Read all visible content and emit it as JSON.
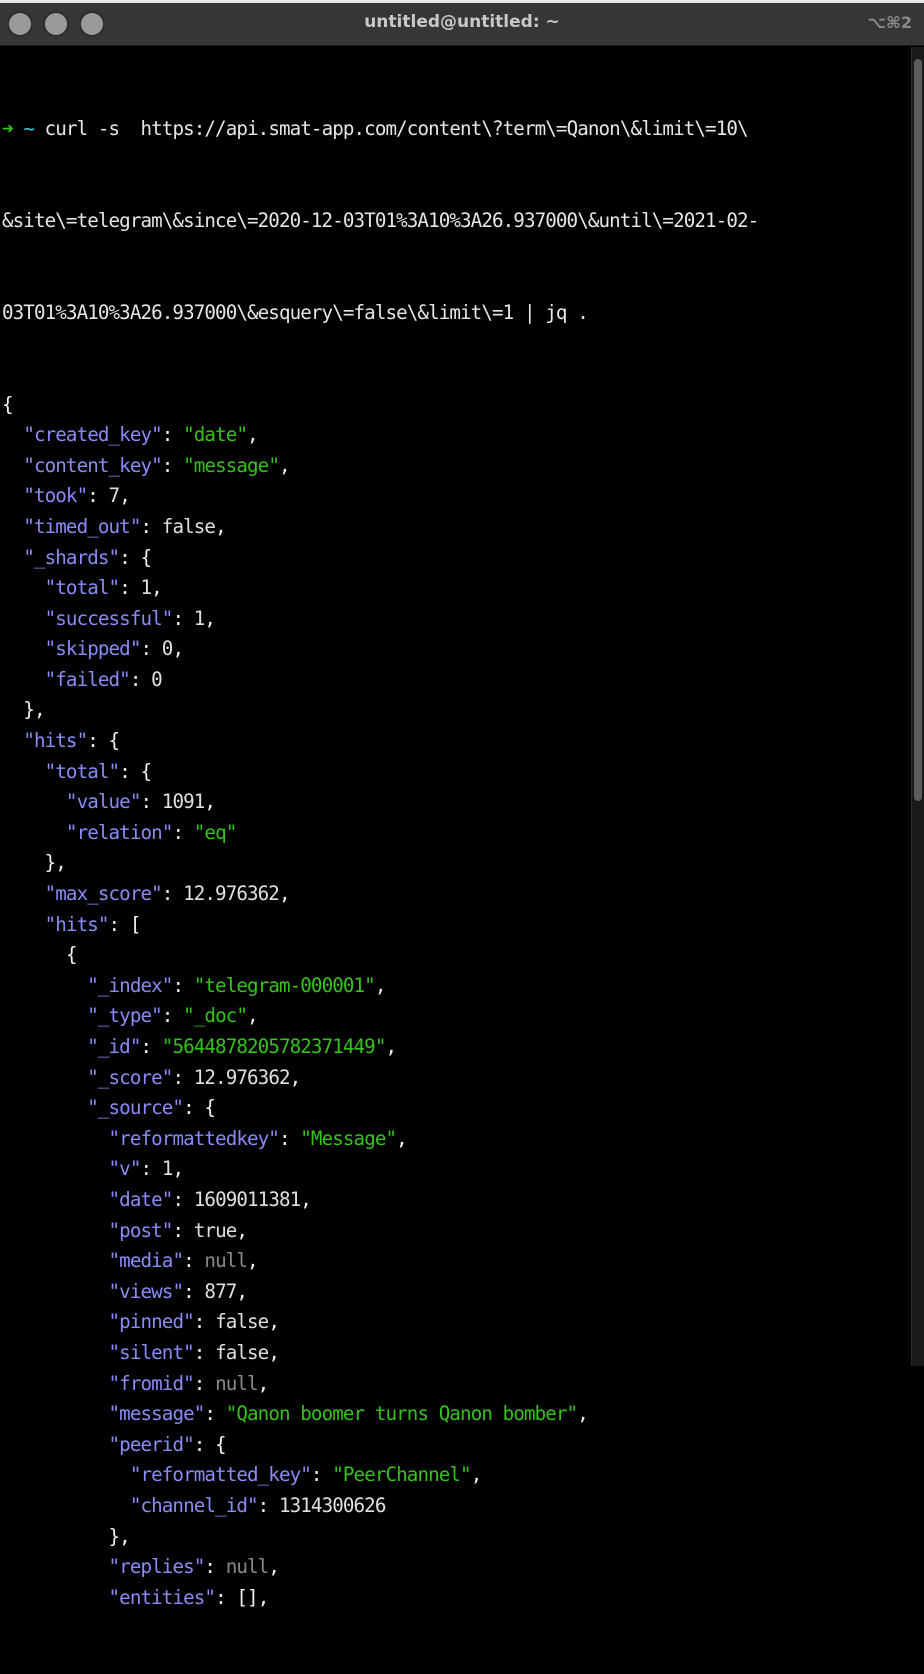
{
  "window": {
    "title": "untitled@untitled: ~",
    "shortcut": "⌥⌘2",
    "scroll_position": 0.0,
    "scroll_visible_fraction": 0.56
  },
  "prompt": {
    "arrow": "➜",
    "cwd": "~",
    "command_lines": [
      "curl -s  https://api.smat-app.com/content\\?term\\=Qanon\\&limit\\=10\\",
      "&site\\=telegram\\&since\\=2020-12-03T01%3A10%3A26.937000\\&until\\=2021-02-",
      "03T01%3A10%3A26.937000\\&esquery\\=false\\&limit\\=1 | jq ."
    ]
  },
  "output_lines": [
    {
      "indent": 0,
      "tokens": [
        {
          "t": "p",
          "v": "{"
        }
      ]
    },
    {
      "indent": 1,
      "tokens": [
        {
          "t": "k",
          "v": "\"created_key\""
        },
        {
          "t": "p",
          "v": ": "
        },
        {
          "t": "s",
          "v": "\"date\""
        },
        {
          "t": "p",
          "v": ","
        }
      ]
    },
    {
      "indent": 1,
      "tokens": [
        {
          "t": "k",
          "v": "\"content_key\""
        },
        {
          "t": "p",
          "v": ": "
        },
        {
          "t": "s",
          "v": "\"message\""
        },
        {
          "t": "p",
          "v": ","
        }
      ]
    },
    {
      "indent": 1,
      "tokens": [
        {
          "t": "k",
          "v": "\"took\""
        },
        {
          "t": "p",
          "v": ": "
        },
        {
          "t": "n",
          "v": "7"
        },
        {
          "t": "p",
          "v": ","
        }
      ]
    },
    {
      "indent": 1,
      "tokens": [
        {
          "t": "k",
          "v": "\"timed_out\""
        },
        {
          "t": "p",
          "v": ": "
        },
        {
          "t": "n",
          "v": "false"
        },
        {
          "t": "p",
          "v": ","
        }
      ]
    },
    {
      "indent": 1,
      "tokens": [
        {
          "t": "k",
          "v": "\"_shards\""
        },
        {
          "t": "p",
          "v": ": {"
        }
      ]
    },
    {
      "indent": 2,
      "tokens": [
        {
          "t": "k",
          "v": "\"total\""
        },
        {
          "t": "p",
          "v": ": "
        },
        {
          "t": "n",
          "v": "1"
        },
        {
          "t": "p",
          "v": ","
        }
      ]
    },
    {
      "indent": 2,
      "tokens": [
        {
          "t": "k",
          "v": "\"successful\""
        },
        {
          "t": "p",
          "v": ": "
        },
        {
          "t": "n",
          "v": "1"
        },
        {
          "t": "p",
          "v": ","
        }
      ]
    },
    {
      "indent": 2,
      "tokens": [
        {
          "t": "k",
          "v": "\"skipped\""
        },
        {
          "t": "p",
          "v": ": "
        },
        {
          "t": "n",
          "v": "0"
        },
        {
          "t": "p",
          "v": ","
        }
      ]
    },
    {
      "indent": 2,
      "tokens": [
        {
          "t": "k",
          "v": "\"failed\""
        },
        {
          "t": "p",
          "v": ": "
        },
        {
          "t": "n",
          "v": "0"
        }
      ]
    },
    {
      "indent": 1,
      "tokens": [
        {
          "t": "p",
          "v": "},"
        }
      ]
    },
    {
      "indent": 1,
      "tokens": [
        {
          "t": "k",
          "v": "\"hits\""
        },
        {
          "t": "p",
          "v": ": {"
        }
      ]
    },
    {
      "indent": 2,
      "tokens": [
        {
          "t": "k",
          "v": "\"total\""
        },
        {
          "t": "p",
          "v": ": {"
        }
      ]
    },
    {
      "indent": 3,
      "tokens": [
        {
          "t": "k",
          "v": "\"value\""
        },
        {
          "t": "p",
          "v": ": "
        },
        {
          "t": "n",
          "v": "1091"
        },
        {
          "t": "p",
          "v": ","
        }
      ]
    },
    {
      "indent": 3,
      "tokens": [
        {
          "t": "k",
          "v": "\"relation\""
        },
        {
          "t": "p",
          "v": ": "
        },
        {
          "t": "s",
          "v": "\"eq\""
        }
      ]
    },
    {
      "indent": 2,
      "tokens": [
        {
          "t": "p",
          "v": "},"
        }
      ]
    },
    {
      "indent": 2,
      "tokens": [
        {
          "t": "k",
          "v": "\"max_score\""
        },
        {
          "t": "p",
          "v": ": "
        },
        {
          "t": "n",
          "v": "12.976362"
        },
        {
          "t": "p",
          "v": ","
        }
      ]
    },
    {
      "indent": 2,
      "tokens": [
        {
          "t": "k",
          "v": "\"hits\""
        },
        {
          "t": "p",
          "v": ": ["
        }
      ]
    },
    {
      "indent": 3,
      "tokens": [
        {
          "t": "p",
          "v": "{"
        }
      ]
    },
    {
      "indent": 4,
      "tokens": [
        {
          "t": "k",
          "v": "\"_index\""
        },
        {
          "t": "p",
          "v": ": "
        },
        {
          "t": "s",
          "v": "\"telegram-000001\""
        },
        {
          "t": "p",
          "v": ","
        }
      ]
    },
    {
      "indent": 4,
      "tokens": [
        {
          "t": "k",
          "v": "\"_type\""
        },
        {
          "t": "p",
          "v": ": "
        },
        {
          "t": "s",
          "v": "\"_doc\""
        },
        {
          "t": "p",
          "v": ","
        }
      ]
    },
    {
      "indent": 4,
      "tokens": [
        {
          "t": "k",
          "v": "\"_id\""
        },
        {
          "t": "p",
          "v": ": "
        },
        {
          "t": "s",
          "v": "\"5644878205782371449\""
        },
        {
          "t": "p",
          "v": ","
        }
      ]
    },
    {
      "indent": 4,
      "tokens": [
        {
          "t": "k",
          "v": "\"_score\""
        },
        {
          "t": "p",
          "v": ": "
        },
        {
          "t": "n",
          "v": "12.976362"
        },
        {
          "t": "p",
          "v": ","
        }
      ]
    },
    {
      "indent": 4,
      "tokens": [
        {
          "t": "k",
          "v": "\"_source\""
        },
        {
          "t": "p",
          "v": ": {"
        }
      ]
    },
    {
      "indent": 5,
      "tokens": [
        {
          "t": "k",
          "v": "\"reformattedkey\""
        },
        {
          "t": "p",
          "v": ": "
        },
        {
          "t": "s",
          "v": "\"Message\""
        },
        {
          "t": "p",
          "v": ","
        }
      ]
    },
    {
      "indent": 5,
      "tokens": [
        {
          "t": "k",
          "v": "\"v\""
        },
        {
          "t": "p",
          "v": ": "
        },
        {
          "t": "n",
          "v": "1"
        },
        {
          "t": "p",
          "v": ","
        }
      ]
    },
    {
      "indent": 5,
      "tokens": [
        {
          "t": "k",
          "v": "\"date\""
        },
        {
          "t": "p",
          "v": ": "
        },
        {
          "t": "n",
          "v": "1609011381"
        },
        {
          "t": "p",
          "v": ","
        }
      ]
    },
    {
      "indent": 5,
      "tokens": [
        {
          "t": "k",
          "v": "\"post\""
        },
        {
          "t": "p",
          "v": ": "
        },
        {
          "t": "n",
          "v": "true"
        },
        {
          "t": "p",
          "v": ","
        }
      ]
    },
    {
      "indent": 5,
      "tokens": [
        {
          "t": "k",
          "v": "\"media\""
        },
        {
          "t": "p",
          "v": ": "
        },
        {
          "t": "nl",
          "v": "null"
        },
        {
          "t": "p",
          "v": ","
        }
      ]
    },
    {
      "indent": 5,
      "tokens": [
        {
          "t": "k",
          "v": "\"views\""
        },
        {
          "t": "p",
          "v": ": "
        },
        {
          "t": "n",
          "v": "877"
        },
        {
          "t": "p",
          "v": ","
        }
      ]
    },
    {
      "indent": 5,
      "tokens": [
        {
          "t": "k",
          "v": "\"pinned\""
        },
        {
          "t": "p",
          "v": ": "
        },
        {
          "t": "n",
          "v": "false"
        },
        {
          "t": "p",
          "v": ","
        }
      ]
    },
    {
      "indent": 5,
      "tokens": [
        {
          "t": "k",
          "v": "\"silent\""
        },
        {
          "t": "p",
          "v": ": "
        },
        {
          "t": "n",
          "v": "false"
        },
        {
          "t": "p",
          "v": ","
        }
      ]
    },
    {
      "indent": 5,
      "tokens": [
        {
          "t": "k",
          "v": "\"fromid\""
        },
        {
          "t": "p",
          "v": ": "
        },
        {
          "t": "nl",
          "v": "null"
        },
        {
          "t": "p",
          "v": ","
        }
      ]
    },
    {
      "indent": 5,
      "tokens": [
        {
          "t": "k",
          "v": "\"message\""
        },
        {
          "t": "p",
          "v": ": "
        },
        {
          "t": "s",
          "v": "\"Qanon boomer turns Qanon bomber\""
        },
        {
          "t": "p",
          "v": ","
        }
      ]
    },
    {
      "indent": 5,
      "tokens": [
        {
          "t": "k",
          "v": "\"peerid\""
        },
        {
          "t": "p",
          "v": ": {"
        }
      ]
    },
    {
      "indent": 6,
      "tokens": [
        {
          "t": "k",
          "v": "\"reformatted_key\""
        },
        {
          "t": "p",
          "v": ": "
        },
        {
          "t": "s",
          "v": "\"PeerChannel\""
        },
        {
          "t": "p",
          "v": ","
        }
      ]
    },
    {
      "indent": 6,
      "tokens": [
        {
          "t": "k",
          "v": "\"channel_id\""
        },
        {
          "t": "p",
          "v": ": "
        },
        {
          "t": "n",
          "v": "1314300626"
        }
      ]
    },
    {
      "indent": 5,
      "tokens": [
        {
          "t": "p",
          "v": "},"
        }
      ]
    },
    {
      "indent": 5,
      "tokens": [
        {
          "t": "k",
          "v": "\"replies\""
        },
        {
          "t": "p",
          "v": ": "
        },
        {
          "t": "nl",
          "v": "null"
        },
        {
          "t": "p",
          "v": ","
        }
      ]
    },
    {
      "indent": 5,
      "tokens": [
        {
          "t": "k",
          "v": "\"entities\""
        },
        {
          "t": "p",
          "v": ": "
        },
        {
          "t": "p",
          "v": "[]"
        },
        {
          "t": "p",
          "v": ","
        }
      ]
    }
  ]
}
